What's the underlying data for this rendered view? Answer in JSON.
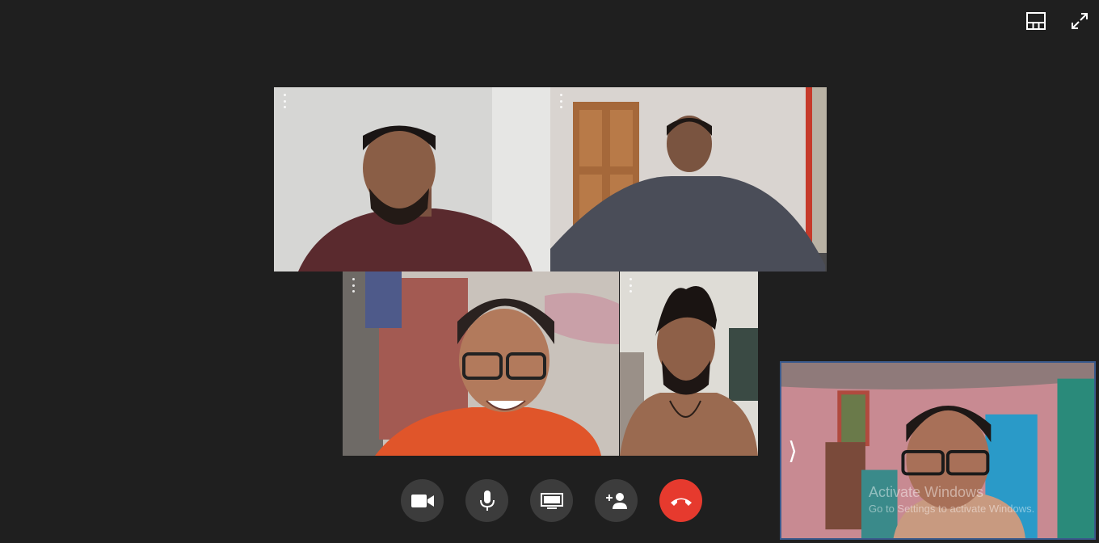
{
  "top_controls": {
    "layout_icon": "grid-layout-icon",
    "fullscreen_icon": "fullscreen-icon"
  },
  "participants": [
    {
      "id": "participant-1",
      "menu_icon": "more-vertical-icon"
    },
    {
      "id": "participant-2",
      "menu_icon": "more-vertical-icon"
    },
    {
      "id": "participant-3",
      "menu_icon": "more-vertical-icon"
    },
    {
      "id": "participant-4",
      "menu_icon": "more-vertical-icon"
    }
  ],
  "self_view": {
    "chevron": "⟩",
    "watermark_title": "Activate Windows",
    "watermark_subtitle": "Go to Settings to activate Windows."
  },
  "call_controls": [
    {
      "name": "camera",
      "icon": "video-camera-icon"
    },
    {
      "name": "microphone",
      "icon": "microphone-icon"
    },
    {
      "name": "screen-share",
      "icon": "screen-share-icon"
    },
    {
      "name": "add-participant",
      "icon": "add-person-icon"
    },
    {
      "name": "end-call",
      "icon": "hang-up-icon"
    }
  ],
  "colors": {
    "background": "#1f1f1f",
    "control_button": "#3c3c3c",
    "end_call": "#e63a2e",
    "self_view_border": "#3a5a8c"
  }
}
